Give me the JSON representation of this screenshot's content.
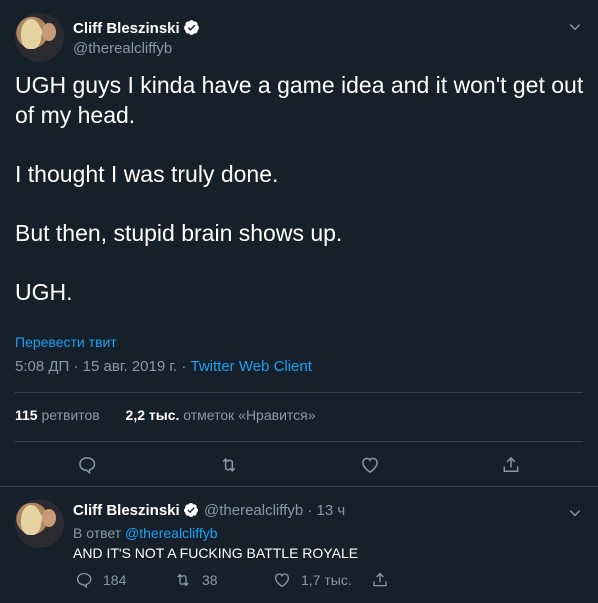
{
  "tweet": {
    "author_name": "Cliff Bleszinski",
    "author_handle": "@therealcliffyb",
    "text_lines": [
      "UGH guys I kinda have a game idea and it won't get out of my head.",
      "I thought I was truly done.",
      "But then, stupid brain shows up.",
      "UGH."
    ],
    "translate_label": "Перевести твит",
    "time": "5:08 ДП",
    "date": "15 авг. 2019 г.",
    "separator": "·",
    "client": "Twitter Web Client",
    "retweets_count": "115",
    "retweets_label": "ретвитов",
    "likes_count": "2,2 тыс.",
    "likes_label": "отметок «Нравится»"
  },
  "reply": {
    "author_name": "Cliff Bleszinski",
    "author_handle_time": "@therealcliffyb · 13 ч",
    "reply_prefix": "В ответ",
    "reply_mention": "@therealcliffyb",
    "text": "AND IT'S NOT A FUCKING BATTLE ROYALE",
    "replies_count": "184",
    "retweets_count": "38",
    "likes_count": "1,7 тыс."
  },
  "icons": [
    "verified-badge-icon",
    "chevron-down-icon",
    "reply-icon",
    "retweet-icon",
    "like-icon",
    "share-icon"
  ],
  "colors": {
    "background": "#15202b",
    "accent": "#1da1f2",
    "secondary_text": "#8899a6",
    "border": "#38444d"
  }
}
